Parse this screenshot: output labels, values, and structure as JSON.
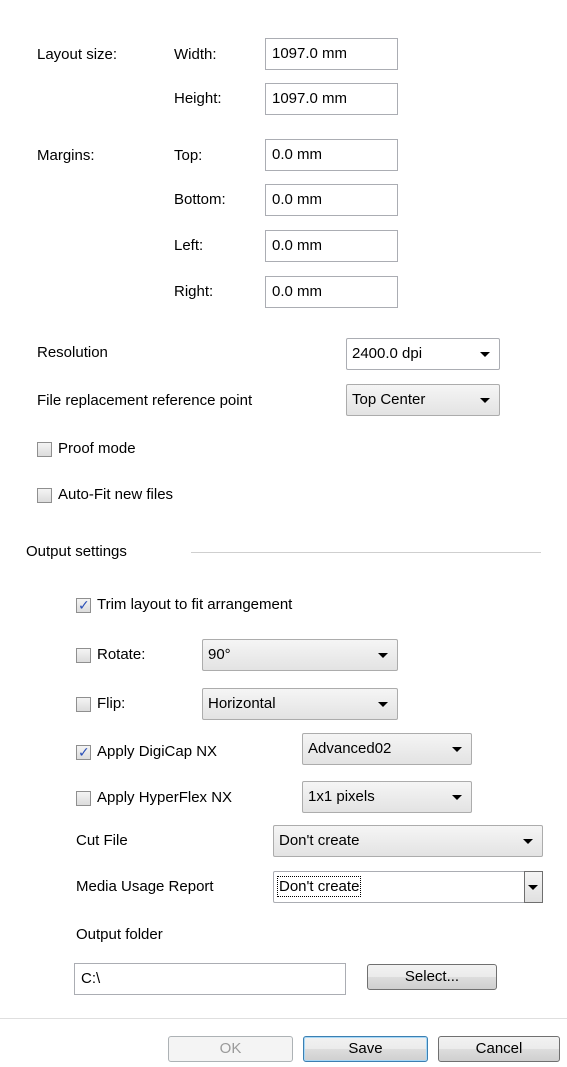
{
  "layout_size": {
    "label": "Layout size:",
    "width_label": "Width:",
    "width_value": "1097.0 mm",
    "height_label": "Height:",
    "height_value": "1097.0 mm"
  },
  "margins": {
    "label": "Margins:",
    "top_label": "Top:",
    "top_value": "0.0 mm",
    "bottom_label": "Bottom:",
    "bottom_value": "0.0 mm",
    "left_label": "Left:",
    "left_value": "0.0 mm",
    "right_label": "Right:",
    "right_value": "0.0 mm"
  },
  "resolution": {
    "label": "Resolution",
    "value": "2400.0 dpi"
  },
  "reference_point": {
    "label": "File replacement reference point",
    "value": "Top Center"
  },
  "proof_mode": {
    "label": "Proof mode",
    "checked": false
  },
  "auto_fit": {
    "label": "Auto-Fit new files",
    "checked": false
  },
  "output_settings": {
    "title": "Output settings",
    "trim": {
      "label": "Trim layout to fit arrangement",
      "checked": true
    },
    "rotate": {
      "label": "Rotate:",
      "checked": false,
      "value": "90°"
    },
    "flip": {
      "label": "Flip:",
      "checked": false,
      "value": "Horizontal"
    },
    "digicap": {
      "label": "Apply DigiCap NX",
      "checked": true,
      "value": "Advanced02"
    },
    "hyperflex": {
      "label": "Apply HyperFlex NX",
      "checked": false,
      "value": "1x1 pixels"
    },
    "cut_file": {
      "label": "Cut File",
      "value": "Don't create"
    },
    "media_report": {
      "label": "Media Usage Report",
      "value": "Don't create"
    },
    "output_folder": {
      "label": "Output folder",
      "value": "C:\\",
      "select_label": "Select..."
    }
  },
  "buttons": {
    "ok": "OK",
    "save": "Save",
    "cancel": "Cancel"
  },
  "colors": {
    "accent_check": "#2a4fb7",
    "default_button_border": "#3c7fb1"
  }
}
